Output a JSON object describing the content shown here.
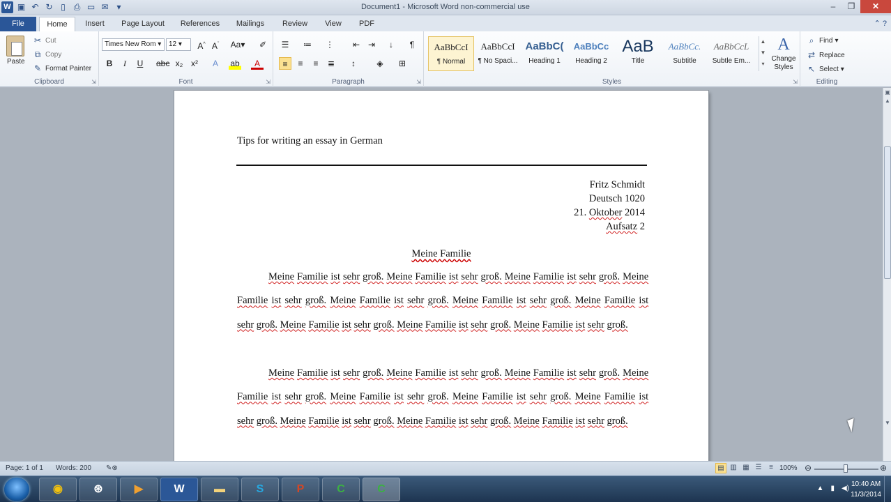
{
  "window": {
    "title": "Document1 - Microsoft Word non-commercial use"
  },
  "tabs": [
    {
      "label": "File"
    },
    {
      "label": "Home"
    },
    {
      "label": "Insert"
    },
    {
      "label": "Page Layout"
    },
    {
      "label": "References"
    },
    {
      "label": "Mailings"
    },
    {
      "label": "Review"
    },
    {
      "label": "View"
    },
    {
      "label": "PDF"
    }
  ],
  "ribbon": {
    "clipboard": {
      "label": "Clipboard",
      "paste": "Paste",
      "cut": "Cut",
      "copy": "Copy",
      "format_painter": "Format Painter"
    },
    "font": {
      "label": "Font",
      "font_name": "Times New Rom",
      "font_size": "12"
    },
    "paragraph": {
      "label": "Paragraph"
    },
    "styles": {
      "label": "Styles",
      "items": [
        {
          "sample": "AaBbCcI",
          "name": "¶ Normal"
        },
        {
          "sample": "AaBbCcI",
          "name": "¶ No Spaci..."
        },
        {
          "sample": "AaBbC(",
          "name": "Heading 1"
        },
        {
          "sample": "AaBbCc",
          "name": "Heading 2"
        },
        {
          "sample": "AaB",
          "name": "Title"
        },
        {
          "sample": "AaBbCc.",
          "name": "Subtitle"
        },
        {
          "sample": "AaBbCcL",
          "name": "Subtle Em..."
        }
      ],
      "change_styles": "Change Styles"
    },
    "editing": {
      "label": "Editing",
      "find": "Find",
      "replace": "Replace",
      "select": "Select"
    }
  },
  "document": {
    "header_title": "Tips for writing an essay in German",
    "author": "Fritz Schmidt",
    "course": "Deutsch 1020",
    "date_day": "21.",
    "date_month": "Oktober",
    "date_year": "2014",
    "assignment_word": "Aufsatz",
    "assignment_num": "2",
    "essay_title": "Meine Familie",
    "sentence": "Meine Familie ist sehr groß.",
    "paragraph_count": 2,
    "sentences_per_paragraph": 10
  },
  "status": {
    "page": "Page: 1 of 1",
    "words": "Words: 200",
    "zoom": "100%"
  },
  "taskbar": {
    "clock_time": "10:40 AM",
    "clock_date": "11/3/2014",
    "apps": [
      "chrome",
      "media-center",
      "media-player",
      "word",
      "explorer",
      "skype",
      "powerpoint",
      "camtasia-recorder",
      "camtasia-studio"
    ]
  }
}
